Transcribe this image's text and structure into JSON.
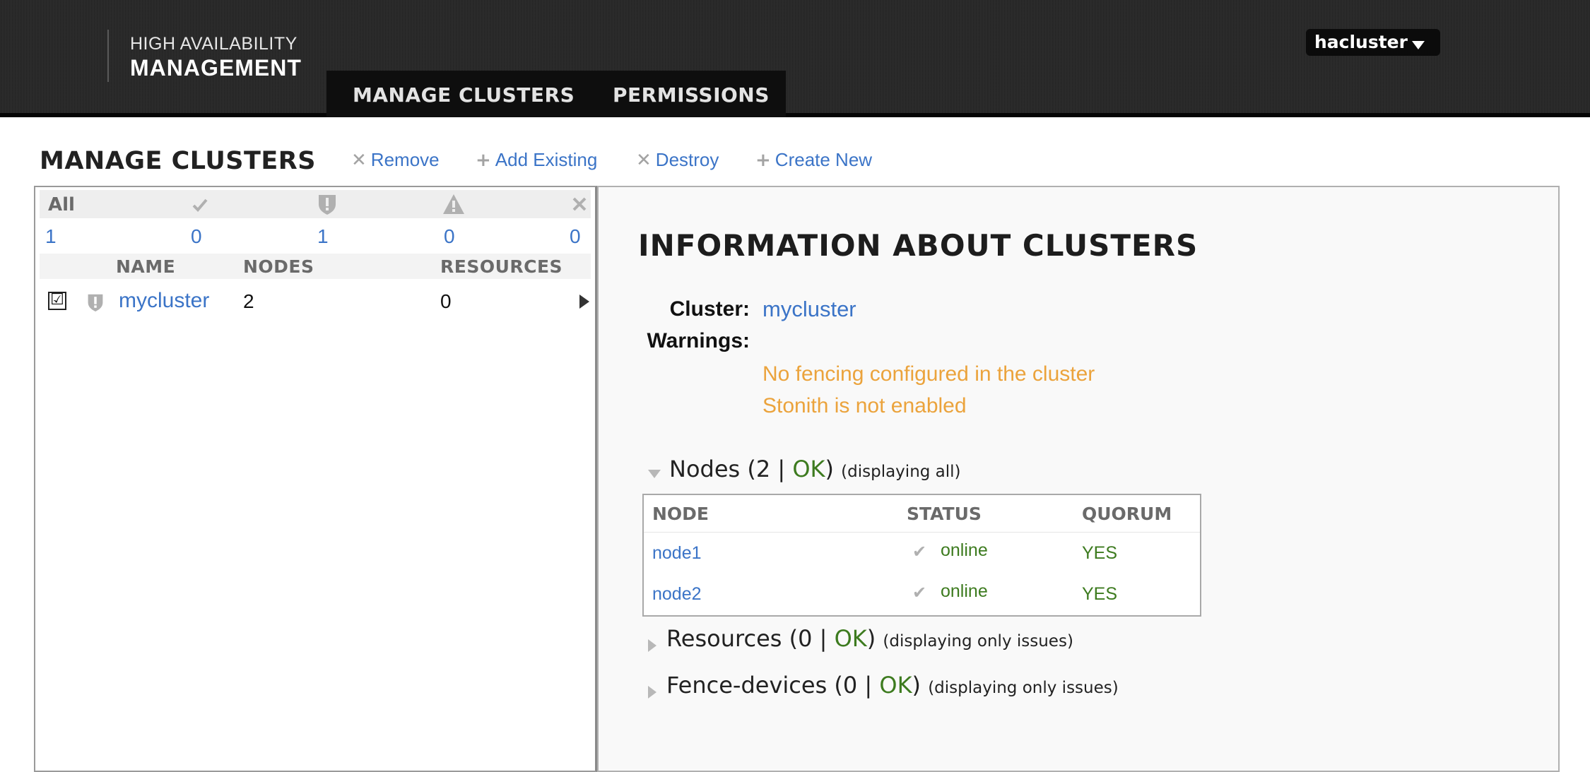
{
  "header": {
    "brand_line1": "HIGH AVAILABILITY",
    "brand_line2": "MANAGEMENT",
    "nav": [
      "MANAGE CLUSTERS",
      "PERMISSIONS"
    ],
    "user": "hacluster"
  },
  "toolbar": {
    "title": "MANAGE CLUSTERS",
    "actions": [
      {
        "symbol": "✕",
        "label": "Remove"
      },
      {
        "symbol": "+",
        "label": "Add Existing"
      },
      {
        "symbol": "✕",
        "label": "Destroy"
      },
      {
        "symbol": "+",
        "label": "Create New"
      }
    ]
  },
  "cluster_list": {
    "filter_all_label": "All",
    "filter_icons": [
      "check-icon",
      "shield-alert-icon",
      "warning-icon",
      "close-icon"
    ],
    "counts": [
      "1",
      "0",
      "1",
      "0",
      "0"
    ],
    "columns": [
      "NAME",
      "NODES",
      "RESOURCES"
    ],
    "rows": [
      {
        "checked": "☑",
        "status_icon": "shield-alert-icon",
        "name": "mycluster",
        "nodes": "2",
        "resources": "0"
      }
    ]
  },
  "info": {
    "title": "INFORMATION ABOUT CLUSTERS",
    "cluster_label": "Cluster:",
    "cluster_name": "mycluster",
    "warnings_label": "Warnings:",
    "warnings": [
      "No fencing configured in the cluster",
      "Stonith is not enabled"
    ],
    "sections": {
      "nodes": {
        "prefix": "Nodes (2 | ",
        "ok": "OK",
        "suffix": ")",
        "note": "(displaying all)"
      },
      "resources": {
        "prefix": "Resources (0 | ",
        "ok": "OK",
        "suffix": ")",
        "note": "(displaying only issues)"
      },
      "fence": {
        "prefix": "Fence-devices (0 | ",
        "ok": "OK",
        "suffix": ")",
        "note": "(displaying only issues)"
      }
    },
    "node_table": {
      "columns": [
        "NODE",
        "STATUS",
        "QUORUM"
      ],
      "rows": [
        {
          "node": "node1",
          "status": "online",
          "quorum": "YES"
        },
        {
          "node": "node2",
          "status": "online",
          "quorum": "YES"
        }
      ]
    }
  },
  "colors": {
    "link": "#3b74c7",
    "warning": "#eba33c",
    "ok": "#3d7b1f",
    "header_bg": "#2b2b2b"
  }
}
